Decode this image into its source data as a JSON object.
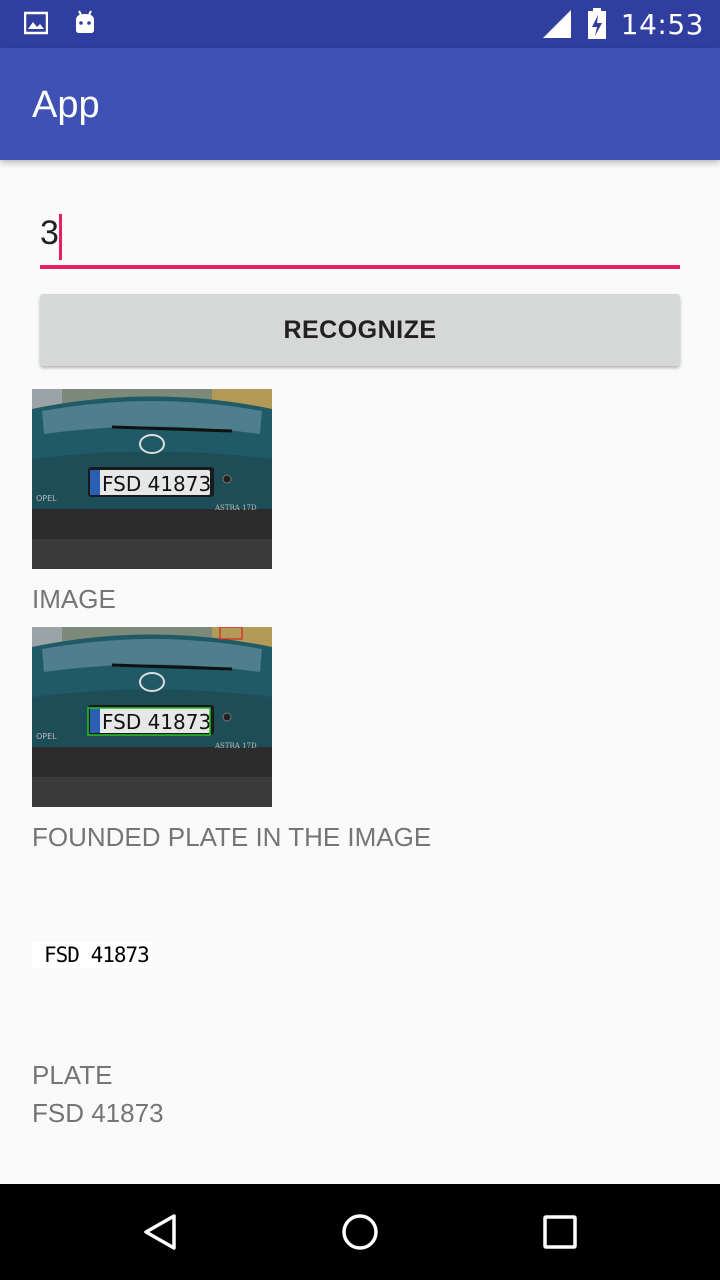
{
  "status_bar": {
    "time": "14:53",
    "icons": [
      "image-notification-icon",
      "android-notification-icon",
      "signal-icon",
      "battery-charging-icon"
    ]
  },
  "app_bar": {
    "title": "App"
  },
  "input": {
    "value": "3"
  },
  "button": {
    "label": "RECOGNIZE"
  },
  "captions": {
    "image": "IMAGE",
    "found": "FOUNDED PLATE IN THE IMAGE",
    "plate": "PLATE",
    "plate_value": "FSD 41873"
  },
  "photos": {
    "plate_text": "FSD 41873",
    "car_badge": "OPEL",
    "model_badge": "ASTRA 17D"
  },
  "plate_crop": {
    "text": "FSD 41873"
  },
  "colors": {
    "status_bar": "#303F9F",
    "app_bar": "#3F51B5",
    "accent": "#E91E63",
    "background": "#FAFAFA",
    "button": "#D6D7D7",
    "detect_box": "#22C322",
    "detect_box_false": "#E02020"
  },
  "nav": {
    "icons": [
      "back-icon",
      "home-icon",
      "recents-icon"
    ]
  }
}
